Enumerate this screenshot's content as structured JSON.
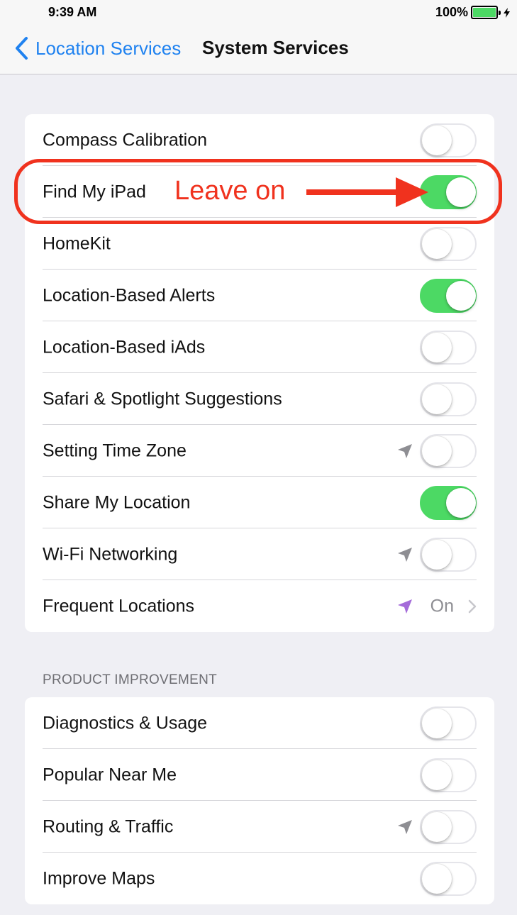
{
  "status_bar": {
    "time": "9:39 AM",
    "battery_percent": "100%"
  },
  "nav": {
    "back_label": "Location Services",
    "title": "System Services"
  },
  "main_group": {
    "rows": [
      {
        "label": "Compass Calibration",
        "toggle": false,
        "location_icon": false
      },
      {
        "label": "Find My iPad",
        "toggle": true,
        "location_icon": false
      },
      {
        "label": "HomeKit",
        "toggle": false,
        "location_icon": false
      },
      {
        "label": "Location-Based Alerts",
        "toggle": true,
        "location_icon": false
      },
      {
        "label": "Location-Based iAds",
        "toggle": false,
        "location_icon": false
      },
      {
        "label": "Safari & Spotlight Suggestions",
        "toggle": false,
        "location_icon": false
      },
      {
        "label": "Setting Time Zone",
        "toggle": false,
        "location_icon": true
      },
      {
        "label": "Share My Location",
        "toggle": true,
        "location_icon": false
      },
      {
        "label": "Wi-Fi Networking",
        "toggle": false,
        "location_icon": true
      },
      {
        "label": "Frequent Locations",
        "value": "On",
        "location_icon": true,
        "location_icon_color": "#a46bd9"
      }
    ]
  },
  "product_improvement": {
    "header": "PRODUCT IMPROVEMENT",
    "rows": [
      {
        "label": "Diagnostics & Usage",
        "toggle": false,
        "location_icon": false
      },
      {
        "label": "Popular Near Me",
        "toggle": false,
        "location_icon": false
      },
      {
        "label": "Routing & Traffic",
        "toggle": false,
        "location_icon": true
      },
      {
        "label": "Improve Maps",
        "toggle": false,
        "location_icon": false
      }
    ]
  },
  "annotation": {
    "text": "Leave on",
    "color": "#f0321e"
  },
  "colors": {
    "accent": "#1f82f0",
    "toggle_on": "#4cd964",
    "background": "#efeff4"
  }
}
